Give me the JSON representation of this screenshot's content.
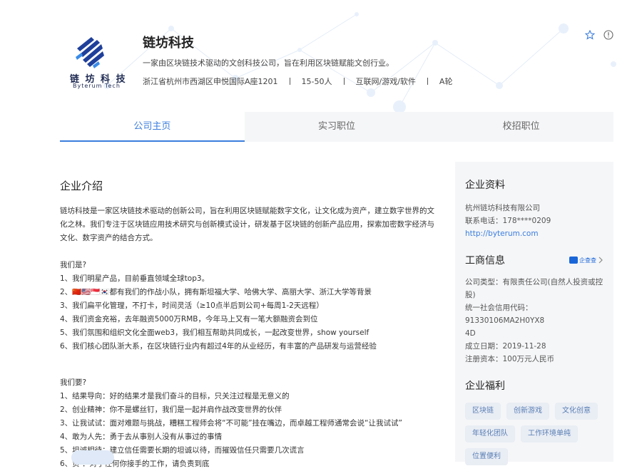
{
  "company": {
    "name": "链坊科技",
    "logo_text": "链 坊 科 技",
    "logo_sub": "Byterum Tech",
    "desc": "一家由区块链技术驱动的文创科技公司，旨在利用区块链赋能文创行业。",
    "location": "浙江省杭州市西湖区申悦国际A座1201",
    "size": "15-50人",
    "industry": "互联网/游戏/软件",
    "round": "A轮"
  },
  "header_icons": [
    "star-icon",
    "info-circle-icon"
  ],
  "tabs": [
    {
      "label": "公司主页"
    },
    {
      "label": "实习职位"
    },
    {
      "label": "校招职位"
    }
  ],
  "intro": {
    "title": "企业介绍",
    "para": "链坊科技是一家区块链技术驱动的创新公司，旨在利用区块链赋能数字文化，让文化成为资产，建立数字世界的文化之林。我们专注于区块链应用技术研究与创新模式设计，研发基于区块链的创新产品应用，探索加密数字经济与文化、数字资产的结合方式。",
    "who_title": "我们是?",
    "who": [
      "1、我们明星产品，目前垂直领域全球top3。",
      "2、🇨🇳🇺🇸🇸🇬🇰🇷都有我们的作战小队，拥有斯坦福大学、哈佛大学、高丽大学、浙江大学等背景",
      "3、我们扁平化管理，不打卡，时间灵活（≥10点半后到公司+每周1-2天远程）",
      "4、我们资金充裕，去年融资5000万RMB，今年马上又有一笔大额融资会到位",
      "5、我们氛围和组织文化全面web3，我们相互帮助共同成长，一起改变世界，show yourself",
      "6、我们核心团队浙大系，在区块链行业内有超过4年的从业经历，有丰富的产品研发与运营经验"
    ],
    "want_title": "我们要?",
    "want": [
      "1、结果导向：好的结果才是我们奋斗的目标，只关注过程是无意义的",
      "2、创业精神：你不是螺丝钉，我们是一起并肩作战改变世界的伙伴",
      "3、让我试试：面对难题与挑战，糟糕工程师会将“不可能”挂在嘴边，而卓越工程师通常会说“让我试试”",
      "4、敢为人先：勇于去从事别人没有从事过的事情",
      "5、坦诚相待：建立信任需要长期的坦诚以待，而摧毁信任只需要几次谎言",
      "6、负      ：对于任何你接手的工作，请负责到底"
    ]
  },
  "side": {
    "profile_title": "企业资料",
    "full_name": "杭州链坊科技有限公司",
    "phone": "联系电话：178****0209",
    "website": "http://byterum.com",
    "biz_title": "工商信息",
    "qcc_label": "企查查",
    "company_type_1": "公司类型：有限责任公司(自然人投资或控",
    "company_type_2": "股)",
    "credit_code_1": "统一社会信用代码：91330106MA2H0YX8",
    "credit_code_2": "4D",
    "founded": "成立日期：2019-11-28",
    "capital": "注册资本：100万元人民币",
    "welfare_title": "企业福利",
    "tags": [
      "区块链",
      "创新游戏",
      "文化创意",
      "年轻化团队",
      "工作环境单纯",
      "位置便利"
    ]
  }
}
